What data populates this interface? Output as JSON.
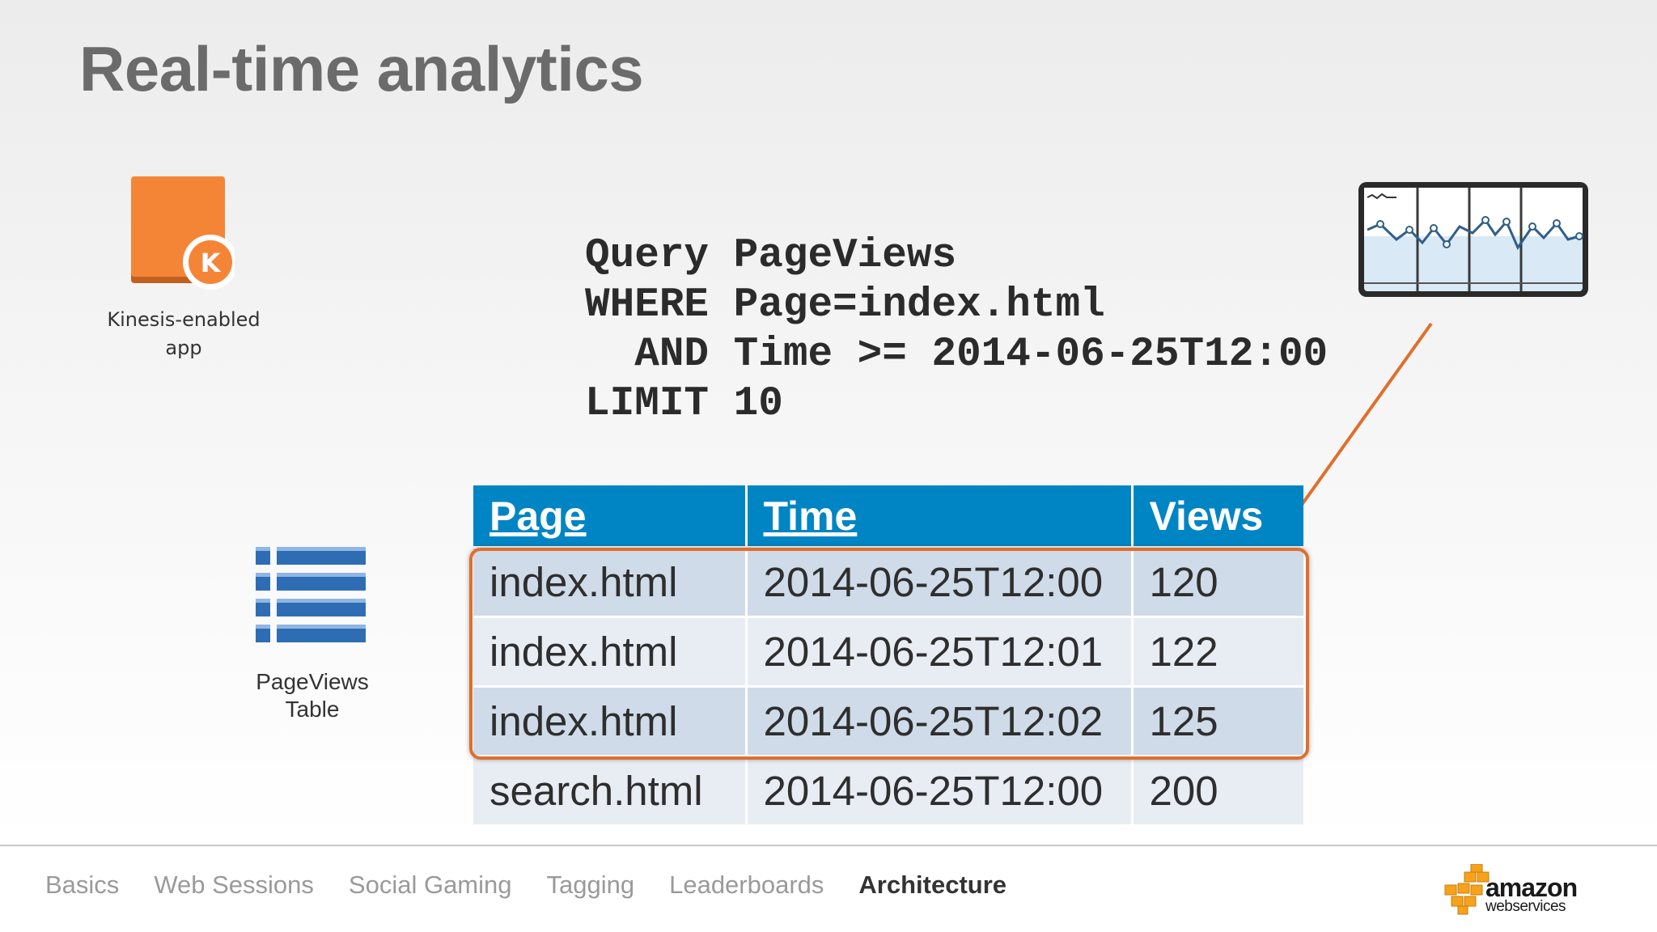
{
  "slide": {
    "title": "Real-time analytics"
  },
  "kinesis_app": {
    "icon_letter": "K",
    "label_line1": "Kinesis-enabled",
    "label_line2": "app",
    "color": "#f58536"
  },
  "query": {
    "lines": [
      "Query PageViews",
      "WHERE Page=index.html",
      "  AND Time >= 2014-06-25T12:00",
      "LIMIT 10"
    ]
  },
  "table_icon": {
    "label_line1": "PageViews",
    "label_line2": "Table",
    "color": "#2e6db4"
  },
  "data_table": {
    "header_color": "#0085c4",
    "highlight_color": "#df6f2c",
    "columns": [
      "Page",
      "Time",
      "Views"
    ],
    "rows": [
      [
        "index.html",
        "2014-06-25T12:00",
        "120"
      ],
      [
        "index.html",
        "2014-06-25T12:01",
        "122"
      ],
      [
        "index.html",
        "2014-06-25T12:02",
        "125"
      ],
      [
        "search.html",
        "2014-06-25T12:00",
        "200"
      ]
    ],
    "highlighted_rows": [
      0,
      1,
      2
    ]
  },
  "dashboard": {
    "icon": "line-chart-dashboard-icon"
  },
  "footer": {
    "nav": [
      {
        "label": "Basics",
        "active": false
      },
      {
        "label": "Web Sessions",
        "active": false
      },
      {
        "label": "Social Gaming",
        "active": false
      },
      {
        "label": "Tagging",
        "active": false
      },
      {
        "label": "Leaderboards",
        "active": false
      },
      {
        "label": "Architecture",
        "active": true
      }
    ],
    "logo_word": "amazon",
    "logo_sub": "webservices",
    "logo_color": "#f7a21b"
  }
}
